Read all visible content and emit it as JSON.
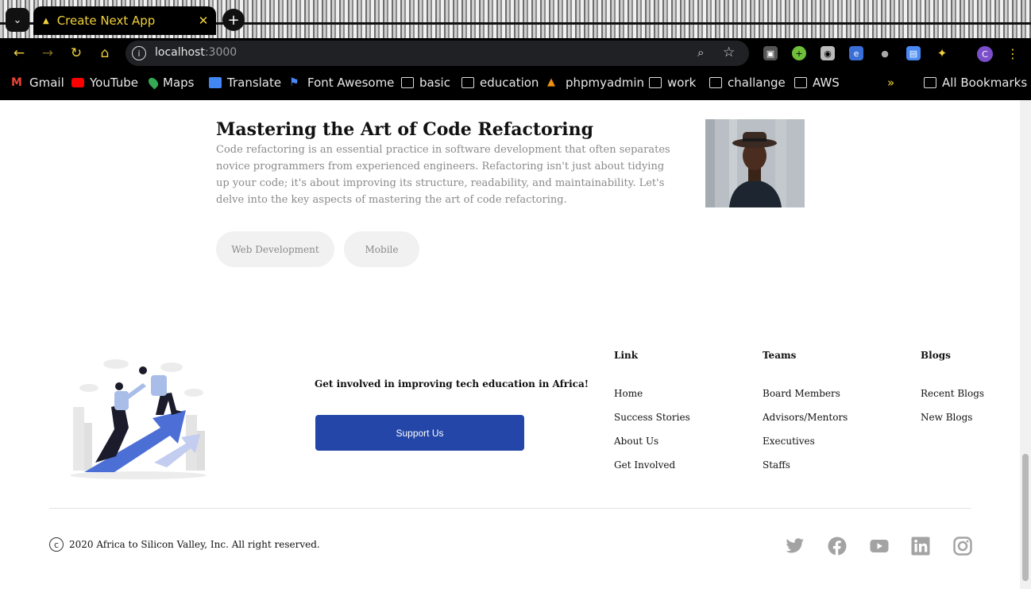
{
  "browser": {
    "tab_title": "Create Next App",
    "url_host": "localhost",
    "url_port": ":3000",
    "bookmarks": [
      {
        "label": "Gmail",
        "icon": "gmail-icon"
      },
      {
        "label": "YouTube",
        "icon": "youtube-icon"
      },
      {
        "label": "Maps",
        "icon": "maps-icon"
      },
      {
        "label": "Translate",
        "icon": "translate-icon"
      },
      {
        "label": "Font Awesome",
        "icon": "font-awesome-icon"
      },
      {
        "label": "basic",
        "icon": "folder-icon"
      },
      {
        "label": "education",
        "icon": "folder-icon"
      },
      {
        "label": "phpmyadmin",
        "icon": "phpmyadmin-icon"
      },
      {
        "label": "work",
        "icon": "folder-icon"
      },
      {
        "label": "challange",
        "icon": "folder-icon"
      },
      {
        "label": "AWS",
        "icon": "folder-icon"
      }
    ],
    "more_bookmarks": "»",
    "all_bookmarks": "All Bookmarks",
    "profile_initial": "C"
  },
  "post": {
    "title": "Mastering the Art of Code Refactoring",
    "excerpt": "Code refactoring is an essential practice in software development that often separates novice programmers from experienced engineers. Refactoring isn't just about tidying up your code; it's about improving its structure, readability, and maintainability. Let's delve into the key aspects of mastering the art of code refactoring.",
    "tags": [
      "Web Development",
      "Mobile"
    ]
  },
  "footer": {
    "cta_text": "Get involved in improving tech education in Africa!",
    "support_label": "Support Us",
    "columns": [
      {
        "heading": "Link",
        "links": [
          "Home",
          "Success Stories",
          "About Us",
          "Get Involved"
        ]
      },
      {
        "heading": "Teams",
        "links": [
          "Board Members",
          "Advisors/Mentors",
          "Executives",
          "Staffs"
        ]
      },
      {
        "heading": "Blogs",
        "links": [
          "Recent Blogs",
          "New Blogs"
        ]
      }
    ],
    "copyright": "2020 Africa to Silicon Valley, Inc. All right reserved.",
    "social": [
      "twitter-icon",
      "facebook-icon",
      "youtube-icon",
      "linkedin-icon",
      "instagram-icon"
    ],
    "brand_color": "#2346a8"
  }
}
